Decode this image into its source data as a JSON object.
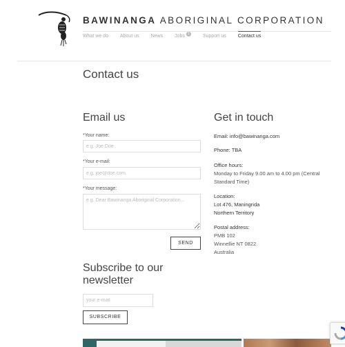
{
  "header": {
    "brand_bold": "BAWINANGA",
    "brand_rest": " ABORIGINAL CORPORATION",
    "nav": [
      {
        "label": "What we do"
      },
      {
        "label": "About us"
      },
      {
        "label": "News"
      },
      {
        "label": "Jobs",
        "badge": "1"
      },
      {
        "label": "Support us"
      },
      {
        "label": "Contact us",
        "active": true
      }
    ]
  },
  "page": {
    "title": "Contact us"
  },
  "email_form": {
    "heading": "Email us",
    "name_label": "Your name:",
    "name_placeholder": "e.g. Joe Doe",
    "email_label": "Your e-mail:",
    "email_placeholder": "e.g. joe@doe.com",
    "message_label": "Your message:",
    "message_placeholder": "e.g. Dear Bawinanga Aboriginal Corporation...",
    "required_mark": "*",
    "send_label": "SEND"
  },
  "get_in_touch": {
    "heading": "Get in touch",
    "email_text": "Email: info@bawinanga.com",
    "phone_text": "Phone: TBA",
    "hours_title": "Office hours:",
    "hours_text": "Monday to Friday 9.00 am to 4.00 pm (Central Standard Time)",
    "location_title": "Location:",
    "location_line1": "Lot 476, Maningrida",
    "location_line2": "Northern Territory",
    "postal_title": "Postal address:",
    "postal_line1": "PMB 102",
    "postal_line2": "Winnellie NT 0822",
    "postal_line3": "Australia"
  },
  "newsletter": {
    "heading": "Subscribe to our newsletter",
    "placeholder": "your e-mail",
    "subscribe_label": "SUBSCRIBE"
  }
}
